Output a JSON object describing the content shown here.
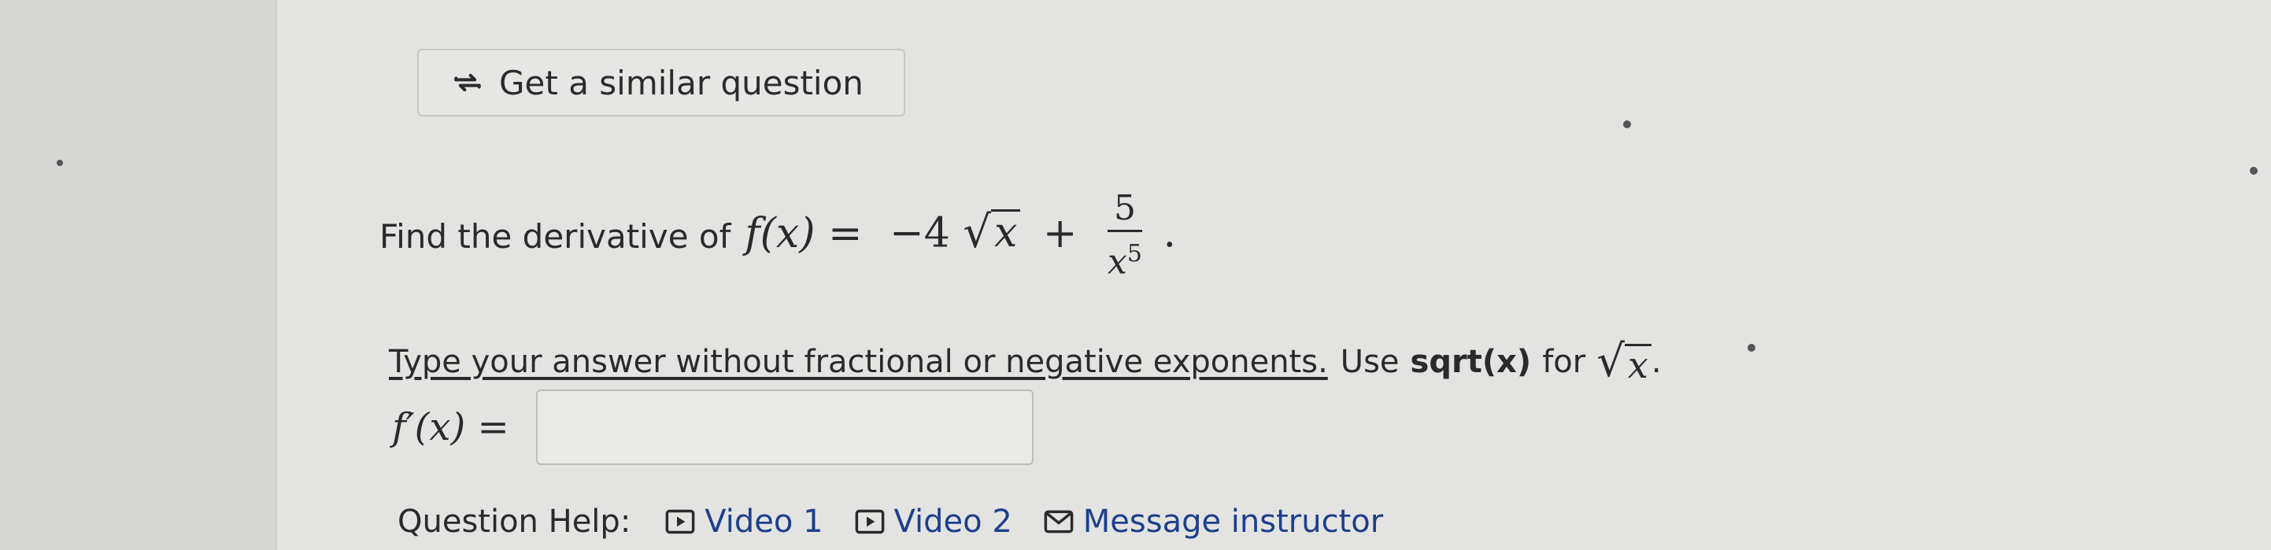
{
  "similar_question": {
    "label": "Get a similar question",
    "icon": "repeat-arrows-icon"
  },
  "question": {
    "prefix": "Find the derivative of",
    "function_lhs": "f(x) =",
    "term1": "−4",
    "radicand": "x",
    "plus": "+",
    "numerator": "5",
    "den_base": "x",
    "den_exp": "5",
    "end": "."
  },
  "instruction": {
    "underlined": "Type your answer without fractional or negative exponents.",
    "use": "Use",
    "code": "sqrt(x)",
    "for": "for",
    "radicand": "x",
    "end": "."
  },
  "answer": {
    "label": "f′(x) =",
    "value": "",
    "placeholder": ""
  },
  "help": {
    "label": "Question Help:",
    "links": [
      {
        "label": "Video 1",
        "icon": "play-icon"
      },
      {
        "label": "Video 2",
        "icon": "play-icon"
      },
      {
        "label": "Message instructor",
        "icon": "envelope-icon"
      }
    ]
  },
  "colors": {
    "link": "#1d3f8c",
    "text": "#2a2a2a",
    "panel_bg": "#e3e3e1"
  }
}
